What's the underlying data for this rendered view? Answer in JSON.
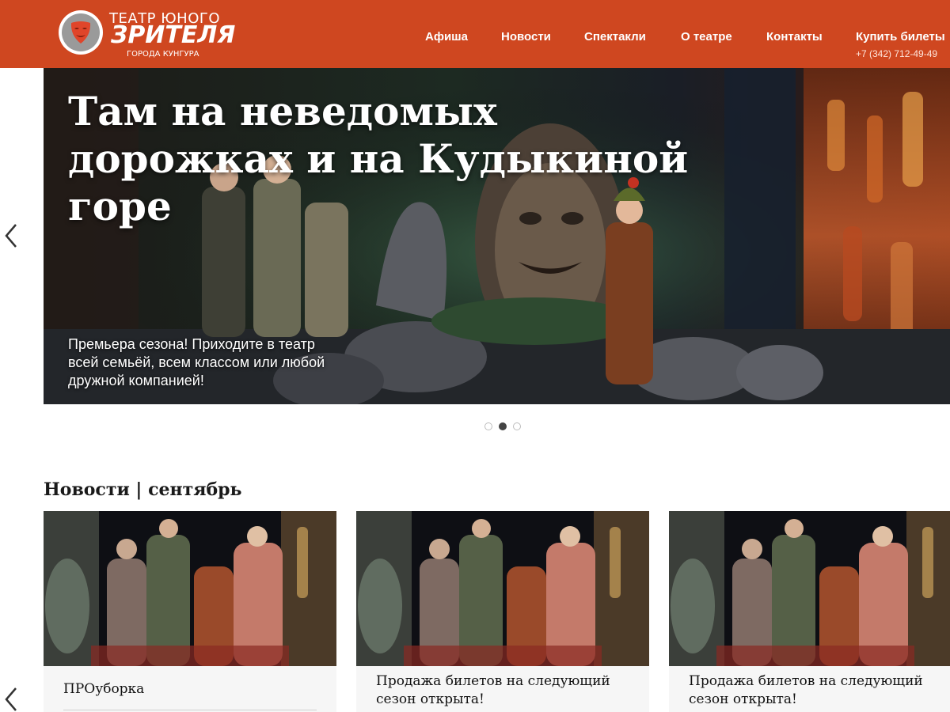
{
  "brand": {
    "line1": "ТЕАТР ЮНОГО",
    "line2": "ЗРИТЕЛЯ",
    "line3": "ГОРОДА КУНГУРА",
    "colors": {
      "header": "#cf4720",
      "mask": "#e0452a"
    }
  },
  "nav": {
    "items": [
      {
        "label": "Афиша"
      },
      {
        "label": "Новости"
      },
      {
        "label": "Спектакли"
      },
      {
        "label": "О театре"
      },
      {
        "label": "Контакты"
      },
      {
        "label": "Купить билеты"
      }
    ],
    "phone": "+7 (342) 712-49-49"
  },
  "hero": {
    "title": "Там на неведомых дорожках и на Кудыкиной горе",
    "subtitle": "Премьера сезона! Приходите в театр всей семьёй, всем классом или любой дружной компанией!",
    "slide_count": 3,
    "active_slide": 2,
    "icons": {
      "prev": "chevron-left-icon"
    }
  },
  "news": {
    "title": "Новости | сентябрь",
    "cards": [
      {
        "title": "ПРОуборка"
      },
      {
        "title": "Продажа билетов на следующий сезон открыта!"
      },
      {
        "title": "Продажа билетов на следующий сезон открыта!"
      }
    ]
  }
}
